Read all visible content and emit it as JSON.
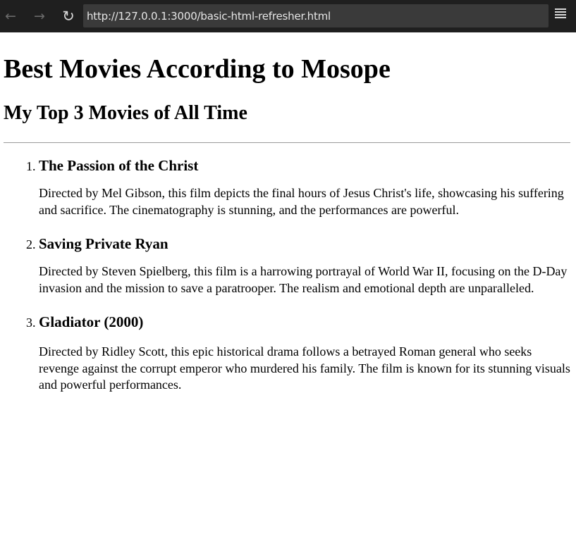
{
  "browser": {
    "url": "http://127.0.0.1:3000/basic-html-refresher.html",
    "back_icon": "arrow-left",
    "forward_icon": "arrow-right",
    "reload_icon": "reload",
    "menu_icon": "hamburger-menu"
  },
  "page": {
    "title": "Best Movies According to Mosope",
    "subtitle": "My Top 3 Movies of All Time",
    "movies": [
      {
        "name": "The Passion of the Christ",
        "description": "Directed by Mel Gibson, this film depicts the final hours of Jesus Christ's life, showcasing his suffering and sacrifice. The cinematography is stunning, and the performances are powerful."
      },
      {
        "name": "Saving Private Ryan",
        "description": "Directed by Steven Spielberg, this film is a harrowing portrayal of World War II, focusing on the D-Day invasion and the mission to save a paratrooper. The realism and emotional depth are unparalleled."
      },
      {
        "name": "Gladiator (2000)",
        "description": "Directed by Ridley Scott, this epic historical drama follows a betrayed Roman general who seeks revenge against the corrupt emperor who murdered his family. The film is known for its stunning visuals and powerful performances."
      }
    ]
  }
}
